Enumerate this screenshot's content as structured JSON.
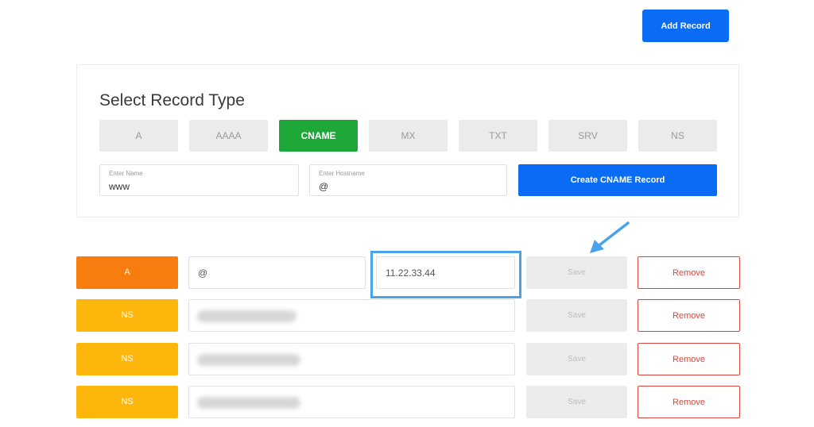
{
  "toolbar": {
    "add_record_label": "Add Record"
  },
  "panel": {
    "title": "Select Record Type",
    "types": [
      "A",
      "AAAA",
      "CNAME",
      "MX",
      "TXT",
      "SRV",
      "NS"
    ],
    "selected_type": "CNAME",
    "name_field": {
      "label": "Enter Name",
      "value": "www"
    },
    "hostname_field": {
      "label": "Enter Hostname",
      "value": "@"
    },
    "create_label": "Create CNAME Record"
  },
  "records": [
    {
      "type": "A",
      "name": "@",
      "value": "11.22.33.44",
      "save_label": "Save",
      "remove_label": "Remove",
      "color": "#f97c0e"
    },
    {
      "type": "NS",
      "name": "",
      "value": "",
      "save_label": "Save",
      "remove_label": "Remove",
      "color": "#fcb60c"
    },
    {
      "type": "NS",
      "name": "",
      "value": "",
      "save_label": "Save",
      "remove_label": "Remove",
      "color": "#fcb60c"
    },
    {
      "type": "NS",
      "name": "",
      "value": "",
      "save_label": "Save",
      "remove_label": "Remove",
      "color": "#fcb60c"
    }
  ],
  "colors": {
    "primary": "#0a6cf5",
    "selected_type": "#1ea83a",
    "remove": "#d8493c",
    "highlight": "#4aa3e8"
  },
  "annotations": {
    "arrow_icon": "arrow-down-left-icon"
  }
}
